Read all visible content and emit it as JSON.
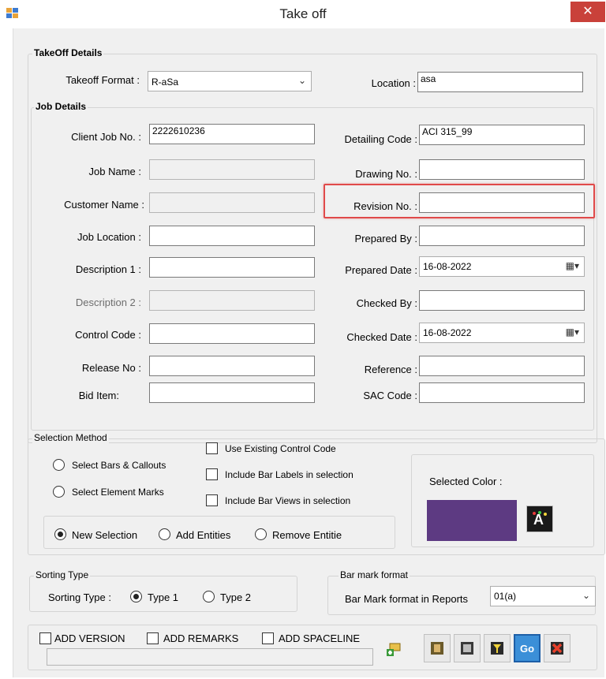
{
  "window": {
    "title": "Take off",
    "close_glyph": "✕"
  },
  "takeoff_details": {
    "group_title": "TakeOff Details",
    "format_label": "Takeoff Format :",
    "format_value": "R-aSa",
    "location_label": "Location :",
    "location_value": "asa"
  },
  "job_details": {
    "group_title": "Job Details",
    "left": [
      {
        "label": "Client Job No. :",
        "value": "2222610236",
        "enabled": true
      },
      {
        "label": "Job Name :",
        "value": "",
        "enabled": false
      },
      {
        "label": "Customer Name :",
        "value": "",
        "enabled": false
      },
      {
        "label": "Job Location :",
        "value": "",
        "enabled": true
      },
      {
        "label": "Description 1 :",
        "value": "",
        "enabled": true
      },
      {
        "label": "Description 2 :",
        "value": "",
        "enabled": false
      },
      {
        "label": "Control Code :",
        "value": "",
        "enabled": true
      },
      {
        "label": "Release No :",
        "value": "",
        "enabled": true
      },
      {
        "label": "Bid  Item:",
        "value": "",
        "enabled": true
      }
    ],
    "right": [
      {
        "label": "Detailing Code :",
        "value": "ACI 315_99"
      },
      {
        "label": "Drawing No. :",
        "value": ""
      },
      {
        "label": "Revision No. :",
        "value": ""
      },
      {
        "label": "Prepared By :",
        "value": ""
      },
      {
        "label": "Prepared Date :",
        "value": "16-08-2022"
      },
      {
        "label": "Checked By :",
        "value": ""
      },
      {
        "label": "Checked Date :",
        "value": "16-08-2022"
      },
      {
        "label": "Reference :",
        "value": ""
      },
      {
        "label": "SAC Code :",
        "value": ""
      }
    ]
  },
  "selection_method": {
    "group_title": "Selection Method",
    "select_bars": "Select Bars & Callouts",
    "select_marks": "Select Element Marks",
    "use_existing": "Use Existing Control Code",
    "include_labels": "Include Bar Labels in selection",
    "include_views": "Include Bar Views  in selection",
    "new_selection": "New Selection",
    "add_entities": "Add Entities",
    "remove_entities": "Remove Entitie",
    "selected_color_label": "Selected Color :",
    "selected_color": "#5d3a82"
  },
  "sorting": {
    "group_title": "Sorting Type",
    "label": "Sorting Type :",
    "type1": "Type 1",
    "type2": "Type 2"
  },
  "bar_mark": {
    "group_title": "Bar mark format",
    "label": "Bar Mark format in Reports",
    "value": "01(a)"
  },
  "bottom": {
    "add_version": "ADD VERSION",
    "add_remarks": "ADD REMARKS",
    "add_spaceline": "ADD SPACELINE",
    "go_label": "Go"
  },
  "icons": [
    "app-icon",
    "close-icon",
    "chevron-down-icon",
    "calendar-icon",
    "color-picker-icon",
    "add-icon",
    "hand-icon",
    "select-icon",
    "filter-icon",
    "go-icon",
    "cancel-icon"
  ],
  "colors": {
    "highlight": "#e04a4a",
    "close": "#c9413a",
    "go": "#3b8fd8"
  }
}
